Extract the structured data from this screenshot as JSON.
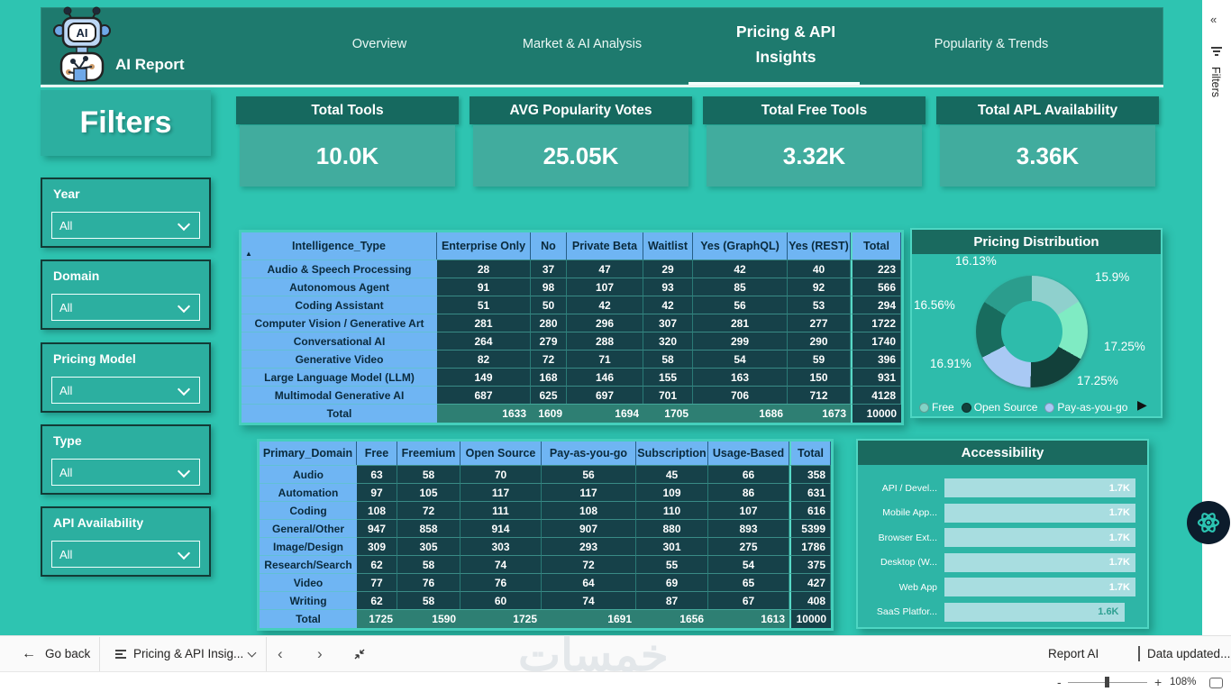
{
  "header": {
    "logo_label": "AI",
    "app_title": "AI Report",
    "tabs": [
      {
        "label": "Overview",
        "active": false
      },
      {
        "label": "Market & AI Analysis",
        "active": false
      },
      {
        "label": "Pricing & API Insights",
        "active": true
      },
      {
        "label": "Popularity & Trends",
        "active": false
      }
    ]
  },
  "kpis": [
    {
      "title": "Total Tools",
      "value": "10.0K"
    },
    {
      "title": "AVG Popularity Votes",
      "value": "25.05K"
    },
    {
      "title": "Total Free Tools",
      "value": "3.32K"
    },
    {
      "title": "Total APL Availability",
      "value": "3.36K"
    }
  ],
  "filters": {
    "panel_title": "Filters",
    "collapsed_pane_label": "Filters",
    "groups": [
      {
        "label": "Year",
        "value": "All"
      },
      {
        "label": "Domain",
        "value": "All"
      },
      {
        "label": "Pricing Model",
        "value": "All"
      },
      {
        "label": "Type",
        "value": "All"
      },
      {
        "label": "API Availability",
        "value": "All"
      }
    ]
  },
  "intelligence_table": {
    "type": "table",
    "columns": [
      "Intelligence_Type",
      "Enterprise Only",
      "No",
      "Private Beta",
      "Waitlist",
      "Yes (GraphQL)",
      "Yes (REST)",
      "Total"
    ],
    "rows": [
      [
        "Audio & Speech Processing",
        28,
        37,
        47,
        29,
        42,
        40,
        223
      ],
      [
        "Autonomous Agent",
        91,
        98,
        107,
        93,
        85,
        92,
        566
      ],
      [
        "Coding Assistant",
        51,
        50,
        42,
        42,
        56,
        53,
        294
      ],
      [
        "Computer Vision / Generative Art",
        281,
        280,
        296,
        307,
        281,
        277,
        1722
      ],
      [
        "Conversational AI",
        264,
        279,
        288,
        320,
        299,
        290,
        1740
      ],
      [
        "Generative Video",
        82,
        72,
        71,
        58,
        54,
        59,
        396
      ],
      [
        "Large Language Model (LLM)",
        149,
        168,
        146,
        155,
        163,
        150,
        931
      ],
      [
        "Multimodal Generative AI",
        687,
        625,
        697,
        701,
        706,
        712,
        4128
      ]
    ],
    "total_row": [
      "Total",
      1633,
      1609,
      1694,
      1705,
      1686,
      1673,
      10000
    ]
  },
  "domain_table": {
    "type": "table",
    "columns": [
      "Primary_Domain",
      "Free",
      "Freemium",
      "Open Source",
      "Pay-as-you-go",
      "Subscription",
      "Usage-Based",
      "Total"
    ],
    "rows": [
      [
        "Audio",
        63,
        58,
        70,
        56,
        45,
        66,
        358
      ],
      [
        "Automation",
        97,
        105,
        117,
        117,
        109,
        86,
        631
      ],
      [
        "Coding",
        108,
        72,
        111,
        108,
        110,
        107,
        616
      ],
      [
        "General/Other",
        947,
        858,
        914,
        907,
        880,
        893,
        5399
      ],
      [
        "Image/Design",
        309,
        305,
        303,
        293,
        301,
        275,
        1786
      ],
      [
        "Research/Search",
        62,
        58,
        74,
        72,
        55,
        54,
        375
      ],
      [
        "Video",
        77,
        76,
        76,
        64,
        69,
        65,
        427
      ],
      [
        "Writing",
        62,
        58,
        60,
        74,
        87,
        67,
        408
      ]
    ],
    "total_row": [
      "Total",
      1725,
      1590,
      1725,
      1691,
      1656,
      1613,
      10000
    ]
  },
  "chart_data": [
    {
      "type": "pie",
      "donut": true,
      "title": "Pricing Distribution",
      "slices": [
        {
          "label": "15.9%",
          "value": 15.9,
          "color": "#8FD0CD"
        },
        {
          "label": "17.25%",
          "value": 17.25,
          "color": "#7FEBC3"
        },
        {
          "label": "17.25%",
          "value": 17.25,
          "color": "#12403A"
        },
        {
          "label": "16.91%",
          "value": 16.91,
          "color": "#A9C9F4"
        },
        {
          "label": "16.56%",
          "value": 16.56,
          "color": "#186C5E"
        },
        {
          "label": "16.13%",
          "value": 16.13,
          "color": "#2B9D8D"
        }
      ],
      "legend_position": "bottom",
      "legend": [
        {
          "label": "Free",
          "color": "#82D3C6"
        },
        {
          "label": "Open Source",
          "color": "#12413B"
        },
        {
          "label": "Pay-as-you-go",
          "color": "#A9C9F4"
        }
      ]
    },
    {
      "type": "bar",
      "orientation": "horizontal",
      "title": "Accessibility",
      "xmax": 1.7,
      "bars": [
        {
          "label": "API / Devel...",
          "value": 1.7,
          "display": "1.7K",
          "value_color": "#FFFFFF"
        },
        {
          "label": "Mobile App...",
          "value": 1.7,
          "display": "1.7K",
          "value_color": "#FFFFFF"
        },
        {
          "label": "Browser Ext...",
          "value": 1.7,
          "display": "1.7K",
          "value_color": "#FFFFFF"
        },
        {
          "label": "Desktop (W...",
          "value": 1.7,
          "display": "1.7K",
          "value_color": "#FFFFFF"
        },
        {
          "label": "Web App",
          "value": 1.7,
          "display": "1.7K",
          "value_color": "#FFFFFF"
        },
        {
          "label": "SaaS Platfor...",
          "value": 1.6,
          "display": "1.6K",
          "value_color": "#2EA092"
        }
      ]
    }
  ],
  "footer": {
    "back_arrow": "←",
    "go_back": "Go back",
    "page_name": "Pricing & API Insig...",
    "prev": "‹",
    "next": "›",
    "report_ai": "Report AI",
    "data_updated": "Data updated...",
    "minus": "-",
    "plus": "+",
    "zoom_level": "108%",
    "watermark": "خمسات"
  },
  "colors": {
    "page_background": "#2EC4B1",
    "header_bar": "#1E7A6E",
    "card_header": "#16695F",
    "table_label_blue": "#6FB5F3",
    "table_dark_cell": "#164149",
    "table_total_cell": "#2E7F73",
    "accessibility_bar": "#A8DDE0"
  }
}
